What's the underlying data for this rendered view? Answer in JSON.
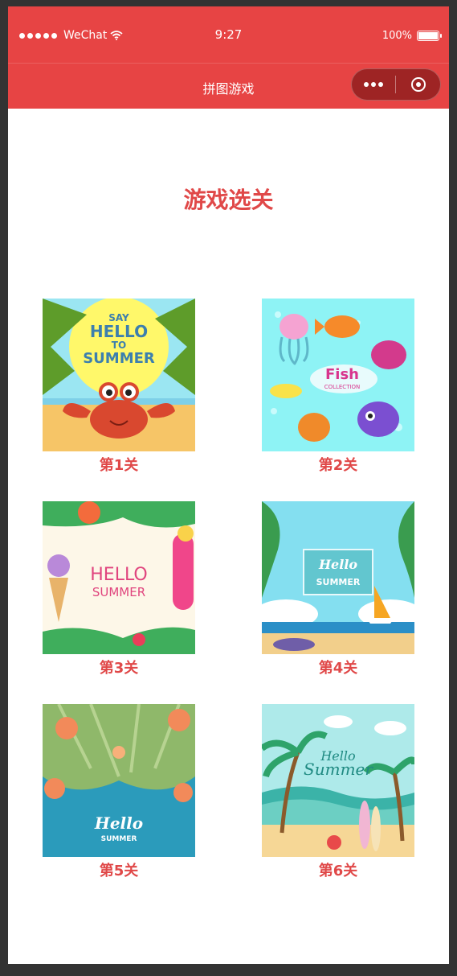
{
  "statusbar": {
    "carrier": "WeChat",
    "time": "9:27",
    "battery": "100%"
  },
  "navbar": {
    "title": "拼图游戏"
  },
  "page": {
    "heading": "游戏选关"
  },
  "levels": [
    {
      "label": "第1关",
      "thumb_text": [
        "SAY",
        "HELLO",
        "TO",
        "SUMMER"
      ]
    },
    {
      "label": "第2关",
      "thumb_text": [
        "Fish",
        "COLLECTION"
      ]
    },
    {
      "label": "第3关",
      "thumb_text": [
        "HELLO",
        "SUMMER"
      ]
    },
    {
      "label": "第4关",
      "thumb_text": [
        "Hello",
        "SUMMER"
      ]
    },
    {
      "label": "第5关",
      "thumb_text": [
        "Hello",
        "SUMMER"
      ]
    },
    {
      "label": "第6关",
      "thumb_text": [
        "Hello",
        "Summer"
      ]
    }
  ],
  "colors": {
    "brand": "#e74444",
    "heading": "#e04848"
  }
}
